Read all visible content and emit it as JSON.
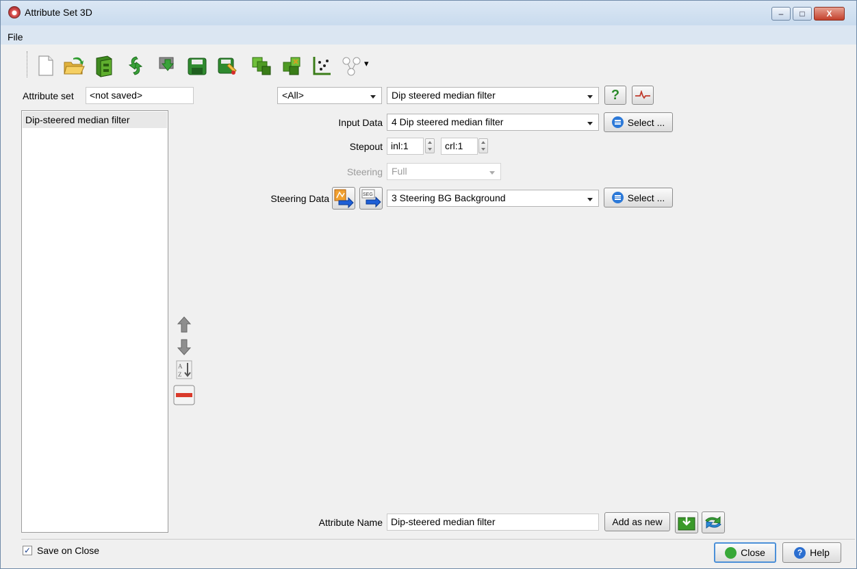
{
  "window": {
    "title": "Attribute Set 3D",
    "controls": {
      "minimize": "–",
      "maximize": "□",
      "close": "X"
    }
  },
  "menu": {
    "file": "File"
  },
  "toolbar": {
    "icons": [
      "new-document-icon",
      "open-folder-icon",
      "cabinet-icon",
      "refresh-icon",
      "import-icon",
      "save-icon",
      "save-as-icon",
      "cube-add-icon",
      "cube-remove-icon",
      "crossplot-icon",
      "tree-graph-icon"
    ],
    "dropdown_arrow": "▾"
  },
  "attribute_set": {
    "label": "Attribute set",
    "value": "<not saved>"
  },
  "attribute_list": {
    "items": [
      "Dip-steered median filter"
    ]
  },
  "filters": {
    "category": "<All>",
    "method": "Dip steered median filter",
    "help_glyph": "?"
  },
  "input_data": {
    "label": "Input Data",
    "value": "4 Dip steered median filter",
    "select_label": "Select ..."
  },
  "stepout": {
    "label": "Stepout",
    "inl": "inl:1",
    "crl": "crl:1"
  },
  "steering": {
    "label": "Steering",
    "value": "Full"
  },
  "steering_data": {
    "label": "Steering Data",
    "value": "3 Steering BG Background",
    "select_label": "Select ...",
    "seg_icon_text": "SEG"
  },
  "attribute_name": {
    "label": "Attribute Name",
    "value": "Dip-steered median filter",
    "add_as_new_label": "Add as new"
  },
  "footer": {
    "save_on_close_label": "Save on Close",
    "save_on_close_checked": true,
    "checkmark": "✓",
    "close_label": "Close",
    "help_label": "Help"
  },
  "colors": {
    "accent": "#2c79d8",
    "title_bar": "#dbe7f4",
    "panel": "#f0f0f0",
    "close_red": "#c2402c"
  }
}
